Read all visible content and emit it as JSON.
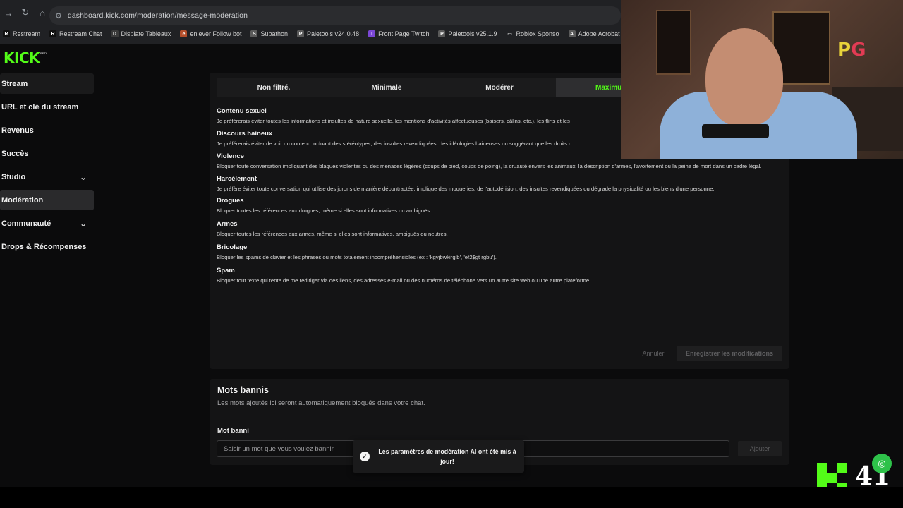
{
  "browser": {
    "url": "dashboard.kick.com/moderation/message-moderation",
    "bookmarks": [
      {
        "label": "Restream",
        "icon": "R",
        "color": "#111111"
      },
      {
        "label": "Restream Chat",
        "icon": "R",
        "color": "#111111"
      },
      {
        "label": "Displate Tableaux",
        "icon": "D",
        "color": "#3a3a3a"
      },
      {
        "label": "enlever Follow bot",
        "icon": "e",
        "color": "#b24d2a"
      },
      {
        "label": "Subathon",
        "icon": "S",
        "color": "#5a5a5a"
      },
      {
        "label": "Paletools v24.0.48",
        "icon": "P",
        "color": "#5a5a5a"
      },
      {
        "label": "Front Page Twitch",
        "icon": "T",
        "color": "#7b47d6"
      },
      {
        "label": "Paletools v25.1.9",
        "icon": "P",
        "color": "#5a5a5a"
      },
      {
        "label": "Roblox Sponso",
        "icon": "▭",
        "color": "#202124"
      },
      {
        "label": "Adobe Acrobat",
        "icon": "A",
        "color": "#5a5a5a"
      }
    ]
  },
  "logo": {
    "text": "KICK",
    "badge": "BETA"
  },
  "sidebar": {
    "items": [
      {
        "label": "Stream",
        "expandable": false
      },
      {
        "label": "URL et clé du stream",
        "expandable": false
      },
      {
        "label": "Revenus",
        "expandable": false
      },
      {
        "label": "Succès",
        "expandable": false
      },
      {
        "label": "Studio",
        "expandable": true
      },
      {
        "label": "Modération",
        "expandable": false
      },
      {
        "label": "Communauté",
        "expandable": true
      },
      {
        "label": "Drops & Récompenses",
        "expandable": false
      }
    ]
  },
  "filter_tabs": [
    "Non filtré.",
    "Minimale",
    "Modérer",
    "Maximu"
  ],
  "categories": [
    {
      "title": "Contenu sexuel",
      "desc": "Je préférerais éviter toutes les informations et insultes de nature sexuelle, les mentions d'activités affectueuses (baisers, câlins, etc.), les flirts et les"
    },
    {
      "title": "Discours haineux",
      "desc": "Je préférerais éviter de voir du contenu incluant des stéréotypes, des insultes revendiquées, des idéologies haineuses ou suggérant que les droits d"
    },
    {
      "title": "Violence",
      "desc": "Bloquer toute conversation impliquant des blagues violentes ou des menaces légères (coups de pied, coups de poing), la cruauté envers les animaux, la description d'armes, l'avortement ou la peine de mort dans un cadre légal."
    },
    {
      "title": "Harcèlement",
      "desc": "Je préfère éviter toute conversation qui utilise des jurons de manière décontractée, implique des moqueries, de l'autodérision, des insultes revendiquées ou dégrade la physicalité ou les biens d'une personne."
    },
    {
      "title": "Drogues",
      "desc": "Bloquer toutes les références aux drogues, même si elles sont informatives ou ambiguës."
    },
    {
      "title": "Armes",
      "desc": "Bloquer toutes les références aux armes, même si elles sont informatives, ambiguës ou neutres."
    },
    {
      "title": "Bricolage",
      "desc": "Bloquer les spams de clavier et les phrases ou mots totalement incompréhensibles (ex : 'kgvjbwkirgjb', 'ef2$gt rgbu')."
    },
    {
      "title": "Spam",
      "desc": "Bloquer tout texte qui tente de me rediriger via des liens, des adresses e-mail ou des numéros de téléphone vers un autre site web ou une autre plateforme."
    }
  ],
  "actions": {
    "cancel": "Annuler",
    "save": "Enregistrer les modifications"
  },
  "banned_words": {
    "title": "Mots bannis",
    "subtitle": "Les mots ajoutés ici seront automatiquement bloqués dans votre chat.",
    "field_label": "Mot banni",
    "placeholder": "Saisir un mot que vous voulez bannir",
    "add": "Ajouter"
  },
  "toast": {
    "message": "Les paramètres de modération AI ont été mis à jour!",
    "icon": "check-circle-icon"
  },
  "overlay": {
    "pg_p": "P",
    "pg_g": "G",
    "counter": "41"
  },
  "colors": {
    "accent": "#53fc18",
    "bg": "#0b0b0c",
    "panel": "#141415"
  }
}
